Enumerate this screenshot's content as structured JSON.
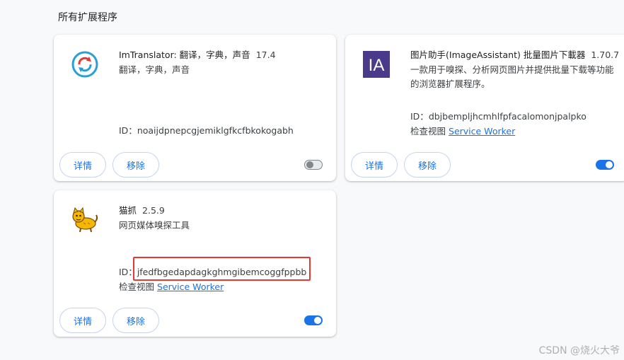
{
  "section": {
    "title": "所有扩展程序"
  },
  "extensions": [
    {
      "name": "ImTranslator: 翻译，字典，声音",
      "version": "17.4",
      "description": "翻译，字典，声音",
      "id_label": "ID：",
      "id": "noaijdpnepcgjemiklgfkcfbkokogabh",
      "details_label": "详情",
      "remove_label": "移除",
      "enabled": false
    },
    {
      "name": "图片助手(ImageAssistant) 批量图片下載器",
      "version": "1.70.7",
      "description": "一款用于嗅探、分析网页图片并提供批量下载等功能的浏览器扩展程序。",
      "id_label": "ID：",
      "id": "dbjbempljhcmhlfpfacalomonjpalpko",
      "inspect_label": "检查视图",
      "inspect_link": "Service Worker",
      "details_label": "详情",
      "remove_label": "移除",
      "icon_text": "IA",
      "enabled": true
    },
    {
      "name": "猫抓",
      "version": "2.5.9",
      "description": "网页媒体嗅探工具",
      "id_label": "ID：",
      "id": "jfedfbgedapdagkghmgibemcoggfppbb",
      "inspect_label": "检查视图",
      "inspect_link": "Service Worker",
      "details_label": "详情",
      "remove_label": "移除",
      "enabled": true
    }
  ],
  "colors": {
    "accent": "#1a73e8",
    "highlight": "#e53935",
    "ia_icon_bg": "#4b3a8a"
  },
  "watermark": "CSDN @烧火大爷"
}
